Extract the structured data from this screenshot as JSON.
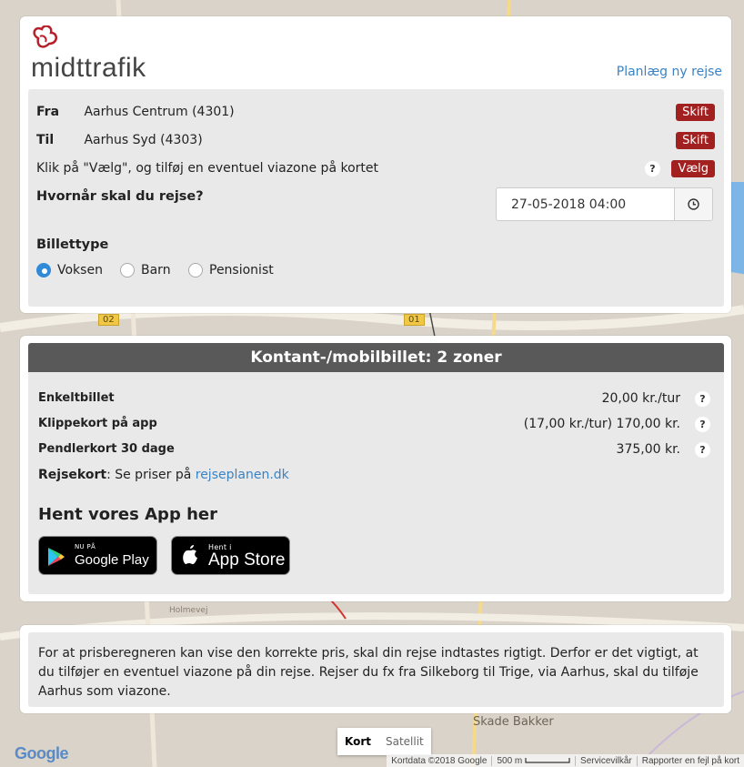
{
  "header": {
    "logo_text": "midttrafik",
    "plan_link": "Planlæg ny rejse"
  },
  "route": {
    "from_label": "Fra",
    "from_value": "Aarhus Centrum (4301)",
    "to_label": "Til",
    "to_value": "Aarhus Syd (4303)",
    "swap_label": "Skift",
    "via_text": "Klik på \"Vælg\", og tilføj en eventuel viazone på kortet",
    "help_label": "?",
    "choose_label": "Vælg",
    "when_label": "Hvornår skal du rejse?",
    "datetime": "27-05-2018 04:00",
    "ticket_type_label": "Billettype",
    "ticket_options": [
      {
        "label": "Voksen",
        "selected": true
      },
      {
        "label": "Barn",
        "selected": false
      },
      {
        "label": "Pensionist",
        "selected": false
      }
    ]
  },
  "prices": {
    "header": "Kontant-/mobilbillet: 2 zoner",
    "rows": [
      {
        "label": "Enkeltbillet",
        "value": "20,00 kr./tur"
      },
      {
        "label": "Klippekort på app",
        "value": "(17,00 kr./tur) 170,00 kr."
      },
      {
        "label": "Pendlerkort 30 dage",
        "value": "375,00 kr."
      }
    ],
    "help_label": "?",
    "rejsekort_label": "Rejsekort",
    "rejsekort_text": ": Se priser på ",
    "rejsekort_link": "rejseplanen.dk",
    "app_title": "Hent vores App her",
    "google_play_small": "NU PÅ",
    "google_play_big": "Google Play",
    "app_store_small": "Hent i",
    "app_store_big": "App Store"
  },
  "info": {
    "text": "For at prisberegneren kan vise den korrekte pris, skal din rejse indtastes rigtigt. Derfor er det vigtigt, at du tilføjer en eventuel viazone på din rejse. Rejser du fx fra Silkeborg til Trige, via Aarhus, skal du tilføje Aarhus som viazone."
  },
  "map": {
    "zone_02": "02",
    "zone_01": "01",
    "place_skade": "Skade Bakker",
    "place_holme": "Holmevej",
    "type_map": "Kort",
    "type_satellite": "Satellit",
    "footer_data": "Kortdata ©2018 Google",
    "footer_scale": "500 m",
    "footer_terms": "Servicevilkår",
    "footer_report": "Rapporter en fejl på kort",
    "google": "Google"
  },
  "colors": {
    "accent_red": "#a32020",
    "link_blue": "#3a83c4",
    "header_grey": "#595959"
  }
}
